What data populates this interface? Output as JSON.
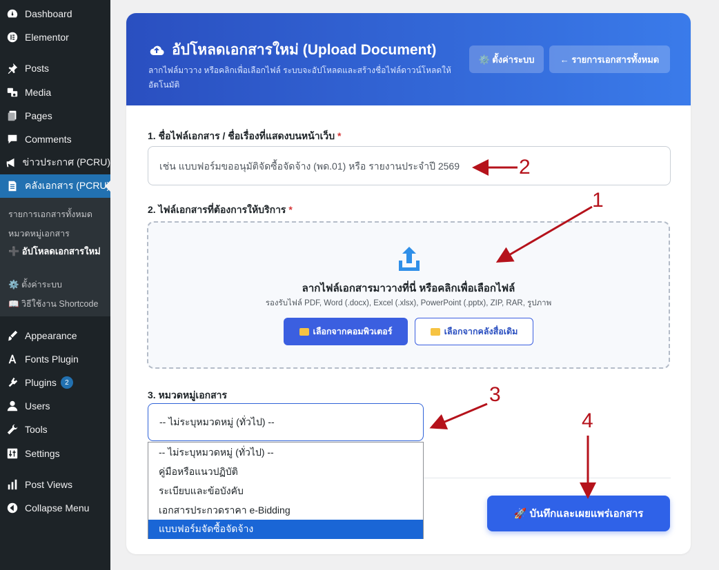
{
  "sidebar": {
    "items": [
      {
        "label": "Dashboard",
        "icon": "dashboard-icon"
      },
      {
        "label": "Elementor",
        "icon": "elementor-icon"
      },
      {
        "label": "Posts",
        "icon": "pin-icon"
      },
      {
        "label": "Media",
        "icon": "media-icon"
      },
      {
        "label": "Pages",
        "icon": "pages-icon"
      },
      {
        "label": "Comments",
        "icon": "comment-icon"
      },
      {
        "label": "ข่าวประกาศ (PCRU)",
        "icon": "megaphone-icon"
      },
      {
        "label": "คลังเอกสาร (PCRU)",
        "icon": "document-icon"
      },
      {
        "label": "Appearance",
        "icon": "brush-icon"
      },
      {
        "label": "Fonts Plugin",
        "icon": "font-icon"
      },
      {
        "label": "Plugins",
        "icon": "plugin-icon",
        "badge": "2"
      },
      {
        "label": "Users",
        "icon": "user-icon"
      },
      {
        "label": "Tools",
        "icon": "wrench-icon"
      },
      {
        "label": "Settings",
        "icon": "settings-icon"
      },
      {
        "label": "Post Views",
        "icon": "bar-chart-icon"
      },
      {
        "label": "Collapse Menu",
        "icon": "collapse-icon"
      }
    ],
    "submenu": [
      {
        "label": "รายการเอกสารทั้งหมด"
      },
      {
        "label": "หมวดหมู่เอกสาร"
      },
      {
        "label": "➕ อัปโหลดเอกสารใหม่"
      },
      {
        "label": "⚙️ ตั้งค่าระบบ"
      },
      {
        "label": "📖 วิธีใช้งาน Shortcode"
      }
    ]
  },
  "header": {
    "title": "อัปโหลดเอกสารใหม่ (Upload Document)",
    "subtitle": "ลากไฟล์มาวาง หรือคลิกเพื่อเลือกไฟล์ ระบบจะอัปโหลดและสร้างชื่อไฟล์ดาวน์โหลดให้อัตโนมัติ",
    "settings_button": "⚙️ ตั้งค่าระบบ",
    "list_button": "← รายการเอกสารทั้งหมด"
  },
  "form": {
    "name_label": "1. ชื่อไฟล์เอกสาร / ชื่อเรื่องที่แสดงบนหน้าเว็บ",
    "name_placeholder": "เช่น แบบฟอร์มขออนุมัติจัดซื้อจัดจ้าง (พด.01) หรือ รายงานประจำปี 2569",
    "file_label": "2. ไฟล์เอกสารที่ต้องการให้บริการ",
    "required_mark": "*",
    "dropzone_title": "ลากไฟล์เอกสารมาวางที่นี่ หรือคลิกเพื่อเลือกไฟล์",
    "dropzone_hint": "รองรับไฟล์ PDF, Word (.docx), Excel (.xlsx), PowerPoint (.pptx), ZIP, RAR, รูปภาพ",
    "computer_button": "เลือกจากคอมพิวเตอร์",
    "library_button": "เลือกจากคลังสื่อเดิม",
    "category_label": "3. หมวดหมู่เอกสาร",
    "category_value": "-- ไม่ระบุหมวดหมู่ (ทั่วไป) --",
    "category_options": [
      "-- ไม่ระบุหมวดหมู่ (ทั่วไป) --",
      "คู่มือหรือแนวปฏิบัติ",
      "ระเบียบและข้อบังคับ",
      "เอกสารประกวดราคา e-Bidding",
      "แบบฟอร์มจัดซื้อจัดจ้าง"
    ],
    "highlighted_option_index": 4,
    "save_button": "🚀 บันทึกและเผยแพร่เอกสาร"
  },
  "annotations": [
    "1",
    "2",
    "3",
    "4"
  ],
  "colors": {
    "sidebar_bg": "#1d2327",
    "active_item": "#2271b1",
    "header_gradient_start": "#2a4fc0",
    "header_gradient_end": "#3a7bea",
    "primary": "#2f62e8",
    "annotation": "#b5121b"
  }
}
